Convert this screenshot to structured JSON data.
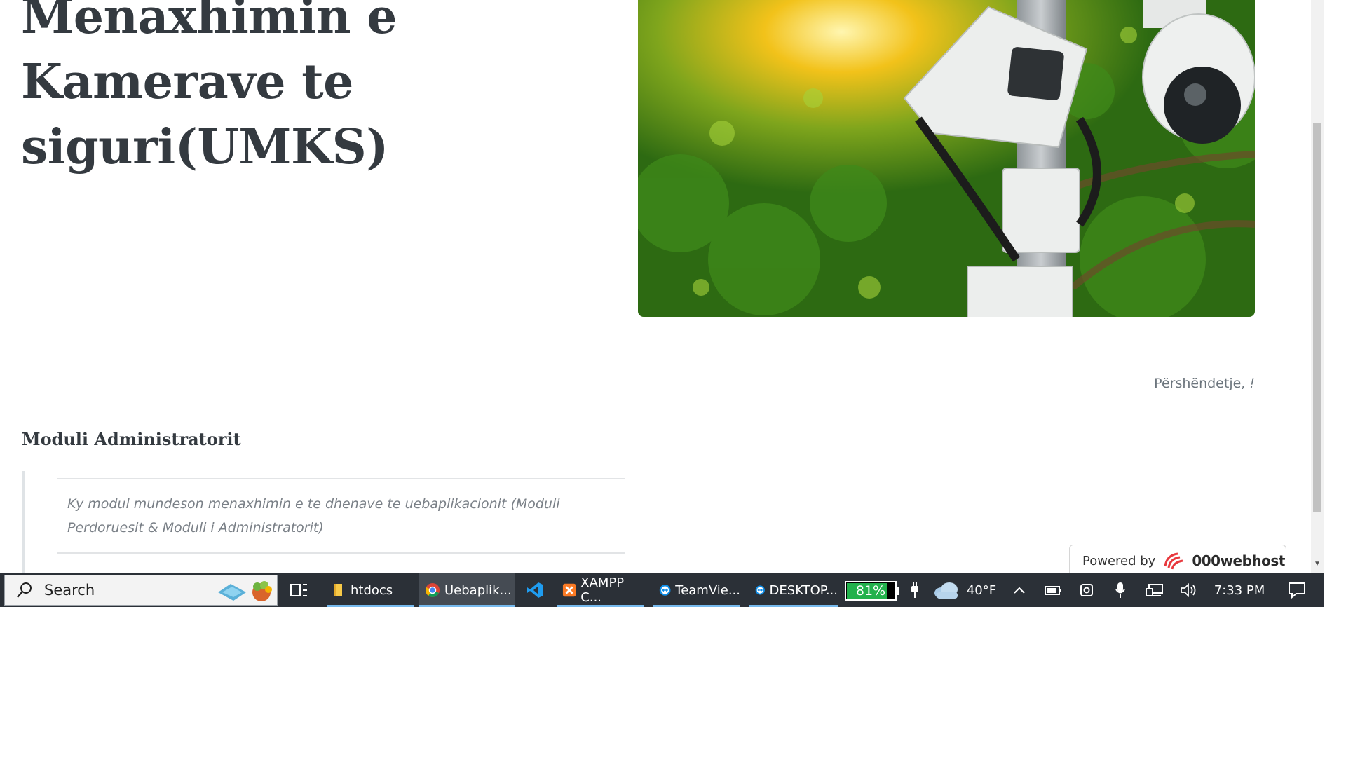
{
  "page": {
    "hero_title": "Menaxhimin e Kamerave te siguri(UMKS)",
    "greeting_text": "Përshëndetje, ",
    "greeting_mark": "!",
    "module_title": "Moduli Administratorit",
    "module_description": "Ky modul mundeson menaxhimin e te dhenave te uebaplikacionit (Moduli Perdoruesit & Moduli i Administratorit)",
    "powered_by_label": "Powered by",
    "powered_by_brand": "000webhost"
  },
  "taskbar": {
    "search_label": "Search",
    "apps": [
      {
        "label": "htdocs",
        "icon": "folder-icon"
      },
      {
        "label": "Uebaplik...",
        "icon": "chrome-icon"
      },
      {
        "label": "",
        "icon": "vscode-icon"
      },
      {
        "label": "XAMPP C...",
        "icon": "xampp-icon"
      },
      {
        "label": "TeamVie...",
        "icon": "teamviewer-icon"
      },
      {
        "label": "DESKTOP...",
        "icon": "teamviewer-icon"
      }
    ],
    "battery_percent": 81,
    "battery_label": "81%",
    "weather_temp": "40°F",
    "clock": "7:33 PM"
  },
  "colors": {
    "heading": "#343a40",
    "muted": "#6c757d",
    "taskbar_bg": "#2b3037",
    "battery_fill": "#22b14c",
    "active_underline": "#76b9ed"
  }
}
